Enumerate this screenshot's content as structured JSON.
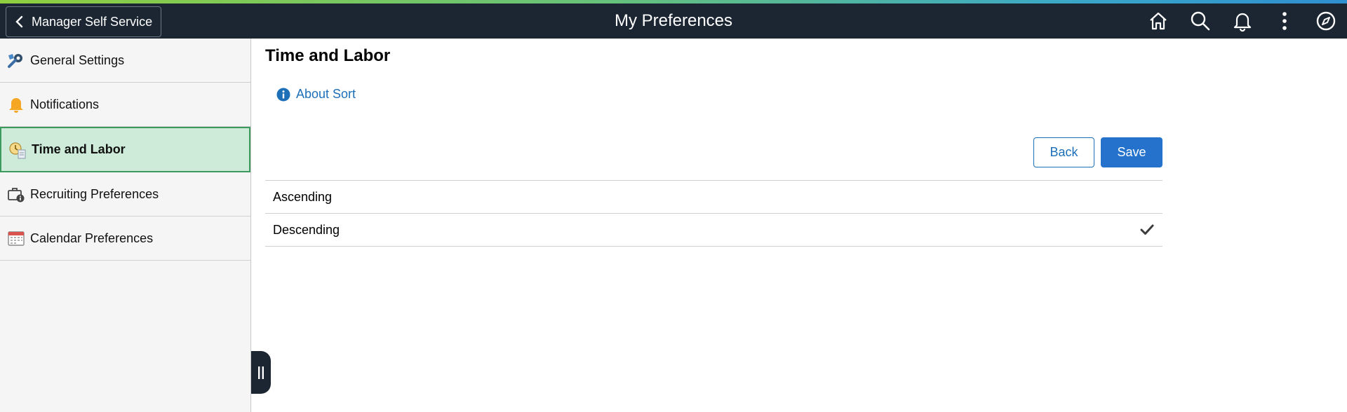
{
  "header": {
    "back_label": "Manager Self Service",
    "title": "My Preferences",
    "icons": [
      "home-icon",
      "search-icon",
      "bell-icon",
      "kebab-menu-icon",
      "compass-icon"
    ]
  },
  "sidebar": {
    "items": [
      {
        "label": "General Settings",
        "icon": "wrench-gear-icon",
        "active": false
      },
      {
        "label": "Notifications",
        "icon": "bell-icon",
        "active": false
      },
      {
        "label": "Time and Labor",
        "icon": "clock-document-icon",
        "active": true
      },
      {
        "label": "Recruiting Preferences",
        "icon": "briefcase-info-icon",
        "active": false
      },
      {
        "label": "Calendar Preferences",
        "icon": "calendar-icon",
        "active": false
      }
    ]
  },
  "main": {
    "title": "Time and Labor",
    "about_link": "About Sort",
    "back_button": "Back",
    "save_button": "Save",
    "sort_options": [
      {
        "label": "Ascending",
        "selected": false
      },
      {
        "label": "Descending",
        "selected": true
      }
    ]
  },
  "colors": {
    "topbar": "#1b2632",
    "accent_blue": "#2472cc",
    "link_blue": "#1d6fb8",
    "active_bg": "#cdebd8",
    "active_border": "#3c9a5f"
  }
}
